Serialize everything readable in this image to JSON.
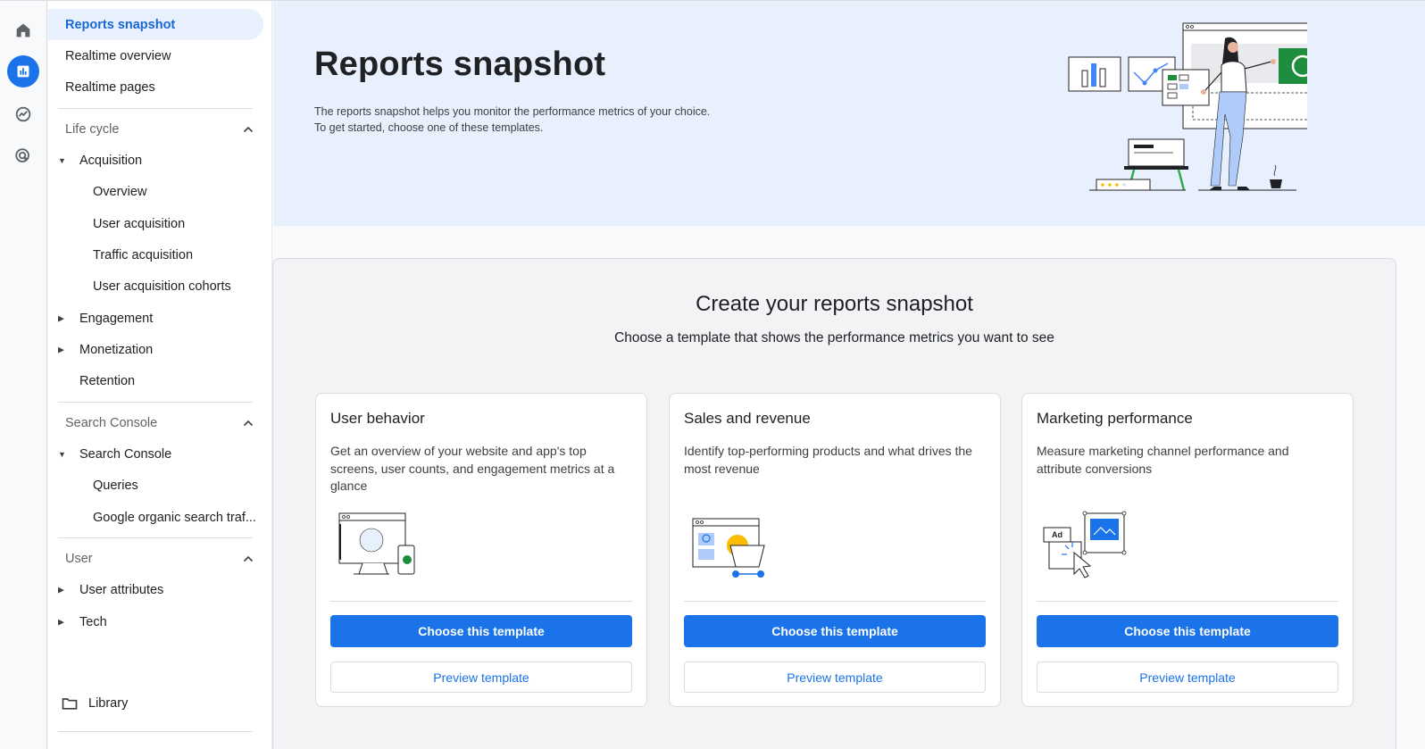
{
  "rail": {
    "items": [
      {
        "icon": "home-icon"
      },
      {
        "icon": "reports-icon",
        "active": true
      },
      {
        "icon": "explore-icon"
      },
      {
        "icon": "advertising-icon"
      }
    ]
  },
  "sidebar": {
    "top_items": [
      {
        "label": "Reports snapshot",
        "selected": true
      },
      {
        "label": "Realtime overview"
      },
      {
        "label": "Realtime pages"
      }
    ],
    "lifecycle": {
      "title": "Life cycle",
      "acquisition": "Acquisition",
      "acquisition_children": [
        "Overview",
        "User acquisition",
        "Traffic acquisition",
        "User acquisition cohorts"
      ],
      "engagement": "Engagement",
      "monetization": "Monetization",
      "retention": "Retention"
    },
    "search_console": {
      "title": "Search Console",
      "group": "Search Console",
      "children": [
        "Queries",
        "Google organic search traf..."
      ]
    },
    "user": {
      "title": "User",
      "attributes": "User attributes",
      "tech": "Tech"
    },
    "library": "Library"
  },
  "banner": {
    "title": "Reports snapshot",
    "desc_line1": "The reports snapshot helps you monitor the performance metrics of your choice.",
    "desc_line2": "To get started, choose one of these templates."
  },
  "panel": {
    "title": "Create your reports snapshot",
    "subtitle": "Choose a template that shows the performance metrics you want to see"
  },
  "cards": [
    {
      "title": "User behavior",
      "desc": "Get an overview of your website and app's top screens, user counts, and engagement metrics at a glance",
      "primary": "Choose this template",
      "secondary": "Preview template"
    },
    {
      "title": "Sales and revenue",
      "desc": "Identify top-performing products and what drives the most revenue",
      "primary": "Choose this template",
      "secondary": "Preview template"
    },
    {
      "title": "Marketing performance",
      "desc": "Measure marketing channel performance and attribute conversions",
      "primary": "Choose this template",
      "secondary": "Preview template"
    }
  ],
  "illustrations": {
    "ad_label": "Ad"
  },
  "colors": {
    "accent": "#1a73e8",
    "selected_bg": "#e8f0fe",
    "banner_bg": "#e8f0fe"
  }
}
